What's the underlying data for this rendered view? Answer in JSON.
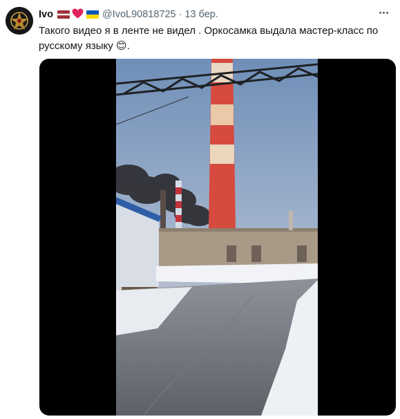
{
  "tweet": {
    "author_name": "Ivo",
    "handle": "@IvoL90818725",
    "separator": "·",
    "timestamp": "13 бер.",
    "text": "Такого видео я в ленте не видел . Оркосамка выдала мастер-класс по русскому языку",
    "text_emoji": "😊",
    "text_end": ".",
    "icons": {
      "avatar": "avatar-emblem",
      "flag_latvia": "latvia-flag-icon",
      "heart": "red-heart-icon",
      "flag_ukraine": "ukraine-flag-icon",
      "more": "more-options-icon"
    },
    "colors": {
      "secondary_text": "#536471",
      "primary_text": "#0f1419",
      "latvia_red": "#9e3039",
      "heart_red": "#e0245e",
      "ukraine_blue": "#0057b7",
      "ukraine_yellow": "#ffd700"
    }
  }
}
